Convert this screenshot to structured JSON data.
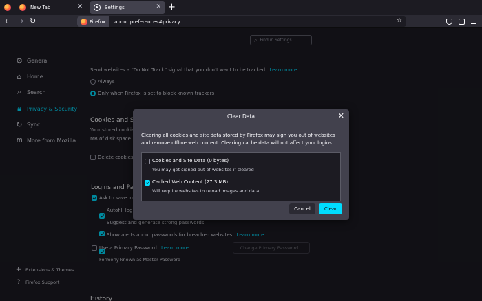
{
  "tabs": [
    {
      "label": "New Tab",
      "close": "✕"
    },
    {
      "label": "Settings",
      "close": "✕"
    }
  ],
  "new_tab_symbol": "+",
  "navbar": {
    "back": "←",
    "forward": "→",
    "reload": "↻",
    "identity_label": "Firefox",
    "url": "about:preferences#privacy",
    "star": "☆"
  },
  "find": {
    "placeholder": "Find in Settings"
  },
  "sidebar": {
    "categories": [
      {
        "label": "General",
        "icon": "gear-icon"
      },
      {
        "label": "Home",
        "icon": "home-icon"
      },
      {
        "label": "Search",
        "icon": "search-icon"
      },
      {
        "label": "Privacy & Security",
        "icon": "lock-icon",
        "selected": true
      },
      {
        "label": "Sync",
        "icon": "sync-icon"
      },
      {
        "label": "More from Mozilla",
        "icon": "mozilla-icon"
      }
    ],
    "footer": [
      {
        "label": "Extensions & Themes",
        "icon": "puzzle-icon"
      },
      {
        "label": "Firefox Support",
        "icon": "help-icon"
      }
    ]
  },
  "content": {
    "dnt_text": "Send websites a “Do Not Track” signal that you don’t want to be tracked",
    "dnt_link": "Learn more",
    "radio_always": "Always",
    "radio_only": "Only when Firefox is set to block known trackers",
    "cookies_heading": "Cookies and Site",
    "cookies_line1": "Your stored cookie",
    "cookies_line2": "MB of disk space.",
    "delete_cookies": "Delete cookies a",
    "logins_heading": "Logins and Pass",
    "ask_to_save": "Ask to save log",
    "autofill": "Autofill login",
    "suggest": "Suggest and generate strong passwords",
    "alerts": "Show alerts about passwords for breached websites",
    "alerts_link": "Learn more",
    "primary_pw": "Use a Primary Password",
    "primary_link": "Learn more",
    "change_pw": "Change Primary Password...",
    "formerly": "Formerly known as Master Password",
    "history_heading": "History"
  },
  "dialog": {
    "title": "Clear Data",
    "close": "✕",
    "description": "Clearing all cookies and site data stored by Firefox may sign you out of websites and remove offline web content. Clearing cache data will not affect your logins.",
    "options": [
      {
        "title": "Cookies and Site Data (0 bytes)",
        "desc": "You may get signed out of websites if cleared",
        "checked": false
      },
      {
        "title": "Cached Web Content (27.3 MB)",
        "desc": "Will require websites to reload images and data",
        "checked": true
      }
    ],
    "cancel": "Cancel",
    "clear": "Clear"
  },
  "colors": {
    "accent": "#00ddff",
    "background": "#1c1b22",
    "dialog": "#42414d"
  }
}
